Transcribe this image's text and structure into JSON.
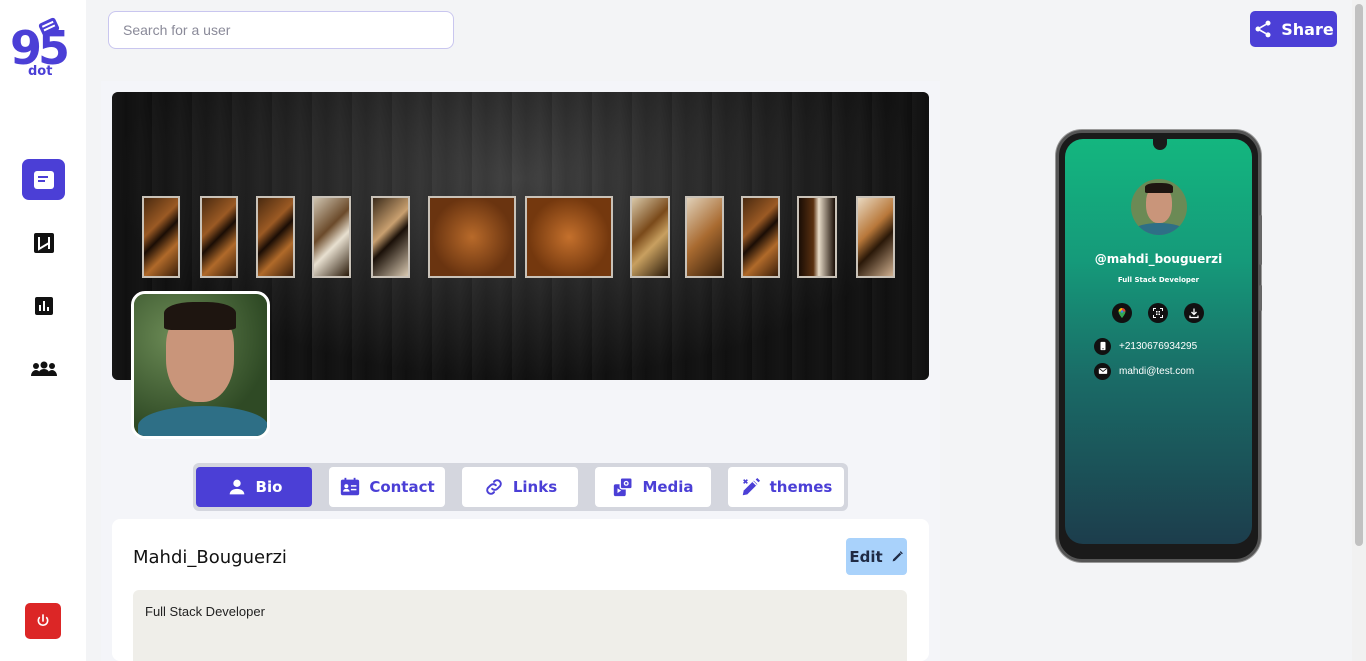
{
  "logo": {
    "number": "95",
    "sub": "dot"
  },
  "sidebar": {
    "items": [
      {
        "name": "profile",
        "icon": "card-icon",
        "active": true
      },
      {
        "name": "nfc",
        "icon": "nfc-icon",
        "active": false
      },
      {
        "name": "analytics",
        "icon": "chart-icon",
        "active": false
      },
      {
        "name": "team",
        "icon": "users-icon",
        "active": false
      }
    ],
    "logout_icon": "power-icon"
  },
  "search": {
    "placeholder": "Search for a user",
    "value": ""
  },
  "header": {
    "share_label": "Share"
  },
  "tabs": [
    {
      "label": "Bio",
      "icon": "user-icon",
      "active": true
    },
    {
      "label": "Contact",
      "icon": "contact-card-icon",
      "active": false
    },
    {
      "label": "Links",
      "icon": "link-icon",
      "active": false
    },
    {
      "label": "Media",
      "icon": "media-icon",
      "active": false
    },
    {
      "label": "themes",
      "icon": "paint-icon",
      "active": false
    }
  ],
  "bio": {
    "name": "Mahdi_Bouguerzi",
    "edit_label": "Edit",
    "text": "Full Stack Developer"
  },
  "preview": {
    "username": "@mahdi_bouguerzi",
    "role": "Full Stack Developer",
    "phone": "+2130676934295",
    "email": "mahdi@test.com"
  },
  "colors": {
    "accent": "#4b3fd6",
    "danger": "#dc2626",
    "edit": "#a9d2fb",
    "preview_top": "#14b67f",
    "preview_bottom": "#1c3d4c"
  }
}
